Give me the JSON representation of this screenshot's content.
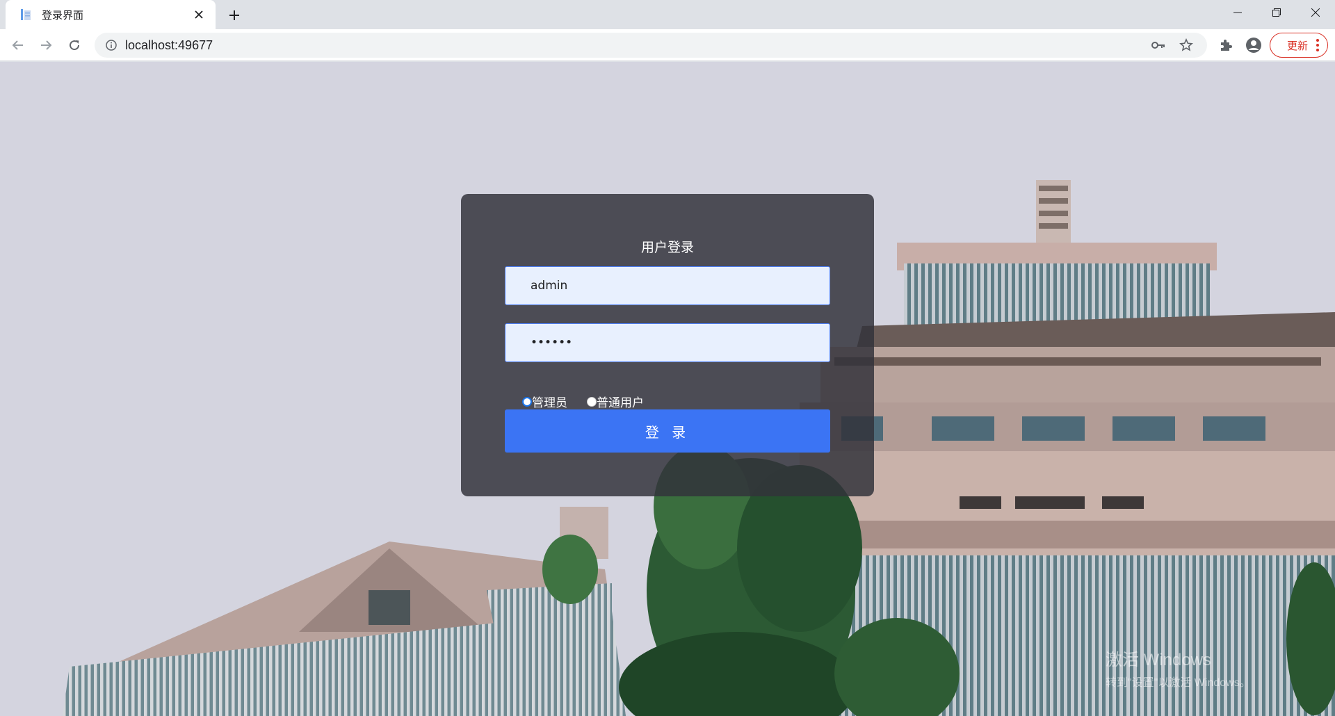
{
  "browser": {
    "tab_title": "登录界面",
    "url": "localhost:49677",
    "update_label": "更新"
  },
  "login": {
    "title": "用户登录",
    "username_value": "admin",
    "password_value": "123456",
    "roles": [
      {
        "label": "管理员",
        "checked": true
      },
      {
        "label": "普通用户",
        "checked": false
      }
    ],
    "submit_label": "登 录"
  },
  "watermark": {
    "line1": "激活 Windows",
    "line2": "转到\"设置\"以激活 Windows。"
  },
  "colors": {
    "card_bg": "#32323a",
    "input_bg": "#e8f0fe",
    "input_border": "#4d7df0",
    "button": "#3b74f4",
    "update_red": "#d93025"
  }
}
